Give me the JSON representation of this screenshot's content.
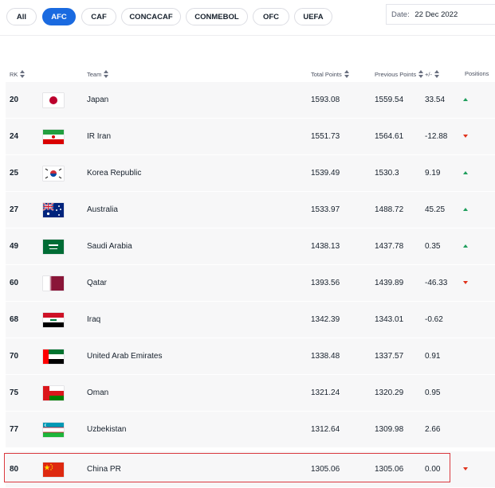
{
  "filters": {
    "chips": [
      "All",
      "AFC",
      "CAF",
      "CONCACAF",
      "CONMEBOL",
      "OFC",
      "UEFA"
    ],
    "active": "AFC"
  },
  "date": {
    "label": "Date:",
    "value": "22 Dec 2022"
  },
  "table": {
    "headers": {
      "rank": "RK",
      "team": "Team",
      "total_points": "Total Points",
      "previous_points": "Previous Points",
      "diff": "+/-",
      "positions": "Positions"
    },
    "rows": [
      {
        "rank": "20",
        "team": "Japan",
        "flag": "japan-flag",
        "total_points": "1593.08",
        "previous_points": "1559.54",
        "diff": "33.54",
        "movement": "up"
      },
      {
        "rank": "24",
        "team": "IR Iran",
        "flag": "iran-flag",
        "total_points": "1551.73",
        "previous_points": "1564.61",
        "diff": "-12.88",
        "movement": "down"
      },
      {
        "rank": "25",
        "team": "Korea Republic",
        "flag": "korea-flag",
        "total_points": "1539.49",
        "previous_points": "1530.3",
        "diff": "9.19",
        "movement": "up"
      },
      {
        "rank": "27",
        "team": "Australia",
        "flag": "australia-flag",
        "total_points": "1533.97",
        "previous_points": "1488.72",
        "diff": "45.25",
        "movement": "up"
      },
      {
        "rank": "49",
        "team": "Saudi Arabia",
        "flag": "saudi-flag",
        "total_points": "1438.13",
        "previous_points": "1437.78",
        "diff": "0.35",
        "movement": "up"
      },
      {
        "rank": "60",
        "team": "Qatar",
        "flag": "qatar-flag",
        "total_points": "1393.56",
        "previous_points": "1439.89",
        "diff": "-46.33",
        "movement": "down"
      },
      {
        "rank": "68",
        "team": "Iraq",
        "flag": "iraq-flag",
        "total_points": "1342.39",
        "previous_points": "1343.01",
        "diff": "-0.62",
        "movement": "none"
      },
      {
        "rank": "70",
        "team": "United Arab Emirates",
        "flag": "uae-flag",
        "total_points": "1338.48",
        "previous_points": "1337.57",
        "diff": "0.91",
        "movement": "none"
      },
      {
        "rank": "75",
        "team": "Oman",
        "flag": "oman-flag",
        "total_points": "1321.24",
        "previous_points": "1320.29",
        "diff": "0.95",
        "movement": "none"
      },
      {
        "rank": "77",
        "team": "Uzbekistan",
        "flag": "uzbekistan-flag",
        "total_points": "1312.64",
        "previous_points": "1309.98",
        "diff": "2.66",
        "movement": "none"
      },
      {
        "rank": "80",
        "team": "China PR",
        "flag": "china-flag",
        "total_points": "1305.06",
        "previous_points": "1305.06",
        "diff": "0.00",
        "movement": "down"
      }
    ]
  },
  "colors": {
    "accent": "#1a6ae0",
    "up": "#1e9e5c",
    "down": "#e0321c",
    "highlight": "#d9383e"
  }
}
